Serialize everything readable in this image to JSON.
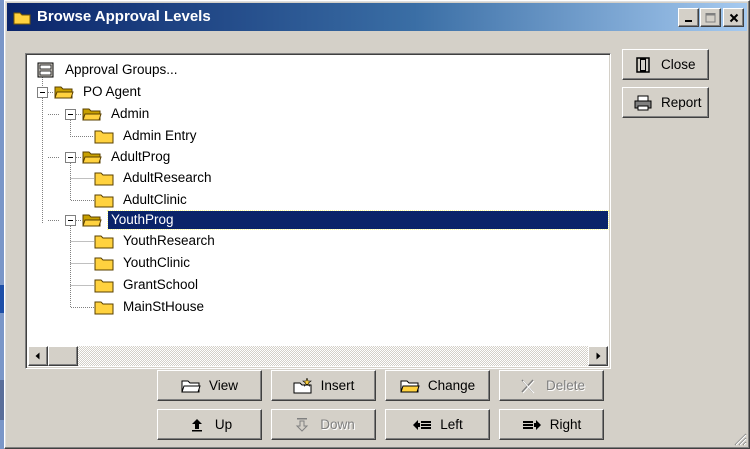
{
  "window": {
    "title": "Browse Approval Levels",
    "controls": [
      "minimize",
      "maximize",
      "close"
    ]
  },
  "tree": {
    "root_label": "Approval Groups...",
    "nodes": [
      {
        "label": "PO Agent",
        "icon": "folder-open-icon",
        "expanded": true
      },
      {
        "label": "Admin",
        "icon": "folder-open-icon",
        "expanded": true
      },
      {
        "label": "Admin Entry",
        "icon": "folder-icon"
      },
      {
        "label": "AdultProg",
        "icon": "folder-open-icon",
        "expanded": true
      },
      {
        "label": "AdultResearch",
        "icon": "folder-icon"
      },
      {
        "label": "AdultClinic",
        "icon": "folder-icon"
      },
      {
        "label": "YouthProg",
        "icon": "folder-open-icon",
        "expanded": true,
        "selected": true
      },
      {
        "label": "YouthResearch",
        "icon": "folder-icon"
      },
      {
        "label": "YouthClinic",
        "icon": "folder-icon"
      },
      {
        "label": "GrantSchool",
        "icon": "folder-icon"
      },
      {
        "label": "MainStHouse",
        "icon": "folder-icon"
      }
    ]
  },
  "side_buttons": {
    "close": {
      "label": "Close",
      "icon": "close-door-icon"
    },
    "report": {
      "label": "Report",
      "icon": "printer-icon"
    }
  },
  "action_buttons": {
    "view": {
      "label": "View",
      "icon": "view-folder-icon",
      "enabled": true
    },
    "insert": {
      "label": "Insert",
      "icon": "insert-folder-icon",
      "enabled": true
    },
    "change": {
      "label": "Change",
      "icon": "change-folder-icon",
      "enabled": true
    },
    "delete": {
      "label": "Delete",
      "icon": "delete-icon",
      "enabled": false
    },
    "up": {
      "label": "Up",
      "icon": "arrow-up-icon",
      "enabled": true
    },
    "down": {
      "label": "Down",
      "icon": "arrow-down-icon",
      "enabled": false
    },
    "left": {
      "label": "Left",
      "icon": "arrow-left-icon",
      "enabled": true
    },
    "right": {
      "label": "Right",
      "icon": "arrow-right-icon",
      "enabled": true
    }
  },
  "colors": {
    "title_bar_start": "#0a246a",
    "title_bar_end": "#a6caf0",
    "selection": "#0a246a",
    "face": "#d4d0c8",
    "folder": "#ffd23f"
  }
}
